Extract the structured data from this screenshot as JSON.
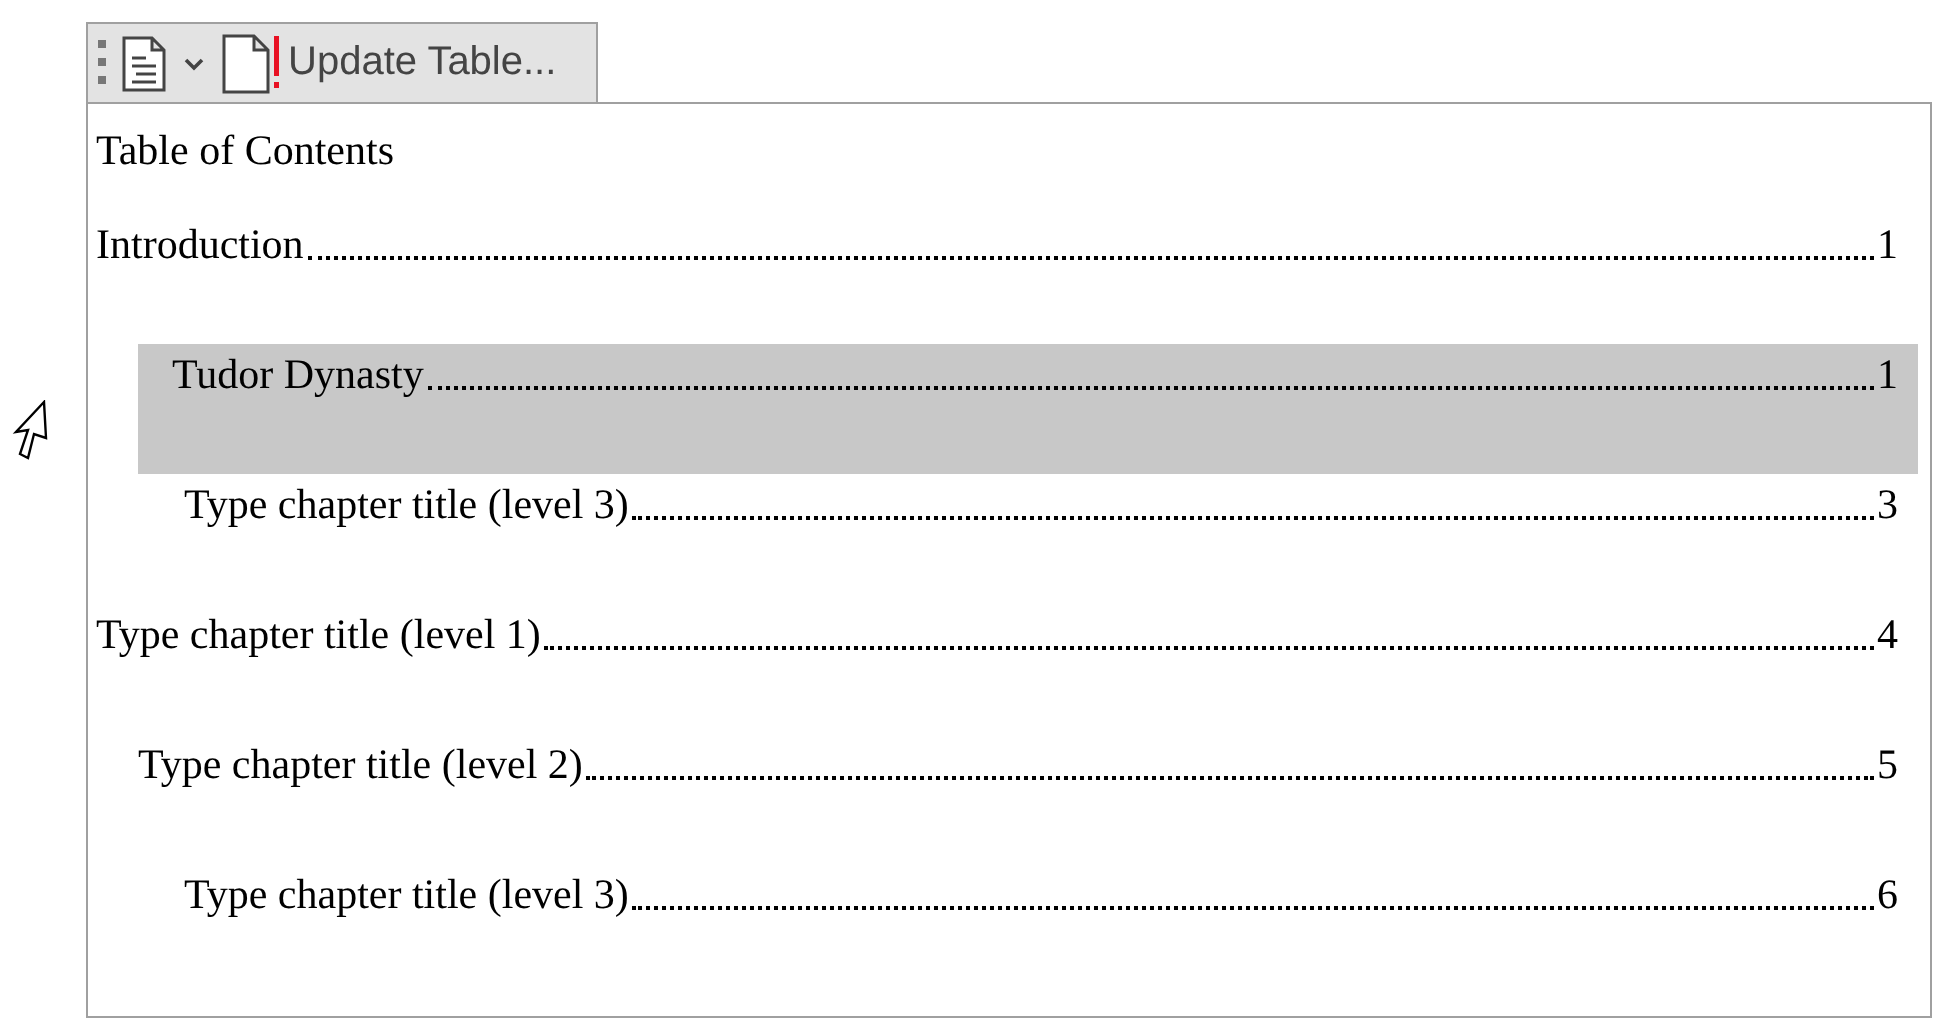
{
  "toolbar": {
    "update_button": "Update Table..."
  },
  "toc": {
    "title": "Table of Contents",
    "entries": [
      {
        "text": "Introduction",
        "page": "1",
        "selected": false,
        "children": [
          {
            "text": "Tudor Dynasty",
            "page": "1",
            "selected": true,
            "children": [
              {
                "text": "Type chapter title (level 3)",
                "page": "3",
                "selected": false
              }
            ]
          }
        ]
      },
      {
        "text": "Type chapter title (level 1)",
        "page": "4",
        "selected": false,
        "children": [
          {
            "text": "Type chapter title (level 2)",
            "page": "5",
            "selected": false,
            "children": [
              {
                "text": "Type chapter title (level 3)",
                "page": "6",
                "selected": false
              }
            ]
          }
        ]
      }
    ]
  }
}
